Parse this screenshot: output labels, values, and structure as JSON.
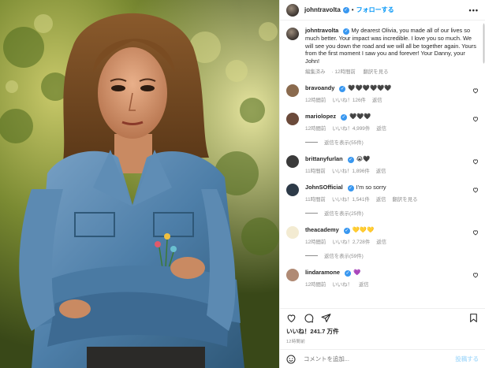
{
  "header": {
    "username": "johntravolta",
    "follow_label": "フォローする",
    "separator": "•",
    "more_label": "•••",
    "verified_mark": "✓"
  },
  "caption": {
    "username": "johntravolta",
    "text": "My dearest Olivia, you made all of our lives so much better. Your impact was incredible. I love you so much. We will see you down the road and we will all be together again. Yours from the first moment I saw you and forever! Your Danny, your John!",
    "edited": "編集済み",
    "age": "12時間前",
    "translate": "翻訳を見る"
  },
  "comments": [
    {
      "username": "bravoandy",
      "text": "🖤🖤🖤🖤🖤🖤",
      "age": "12時間前",
      "likes": "いいね！126件",
      "reply": "返信",
      "avatar_color": "#8a6a4e"
    },
    {
      "username": "mariolopez",
      "text": "🖤🖤🖤",
      "age": "12時間前",
      "likes": "いいね！4,999件",
      "reply": "返信",
      "replies": "返信を表示(55件)",
      "avatar_color": "#6b4a3a"
    },
    {
      "username": "brittanyfurlan",
      "text": "😭🖤",
      "age": "11時間前",
      "likes": "いいね！1,896件",
      "reply": "返信",
      "avatar_color": "#3a3a3a"
    },
    {
      "username": "JohnSOfficial",
      "text": "I'm so sorry",
      "age": "11時間前",
      "likes": "いいね！1,541件",
      "reply": "返信",
      "translate": "翻訳を見る",
      "replies": "返信を表示(25件)",
      "avatar_color": "#2d3a48"
    },
    {
      "username": "theacademy",
      "text": "💛💛💛",
      "age": "12時間前",
      "likes": "いいね！2,728件",
      "reply": "返信",
      "replies": "返信を表示(59件)",
      "avatar_color": "#f3ebd2"
    },
    {
      "username": "lindaramone",
      "text": "💜",
      "age": "12時間前",
      "likes": "いいね！",
      "reply": "返信",
      "avatar_color": "#b08a74"
    }
  ],
  "actions": {
    "icons": [
      "heart-icon",
      "comment-icon",
      "share-icon",
      "bookmark-icon"
    ]
  },
  "likes": {
    "text": "いいね！241.7 万件"
  },
  "time": {
    "text": "12時間前"
  },
  "add_comment": {
    "placeholder": "コメントを追加...",
    "post_label": "投稿する"
  },
  "colors": {
    "accent": "#0095f6",
    "verified": "#3897f0",
    "muted": "#8e8e8e",
    "text": "#262626",
    "post_disabled": "#b2dffc"
  }
}
